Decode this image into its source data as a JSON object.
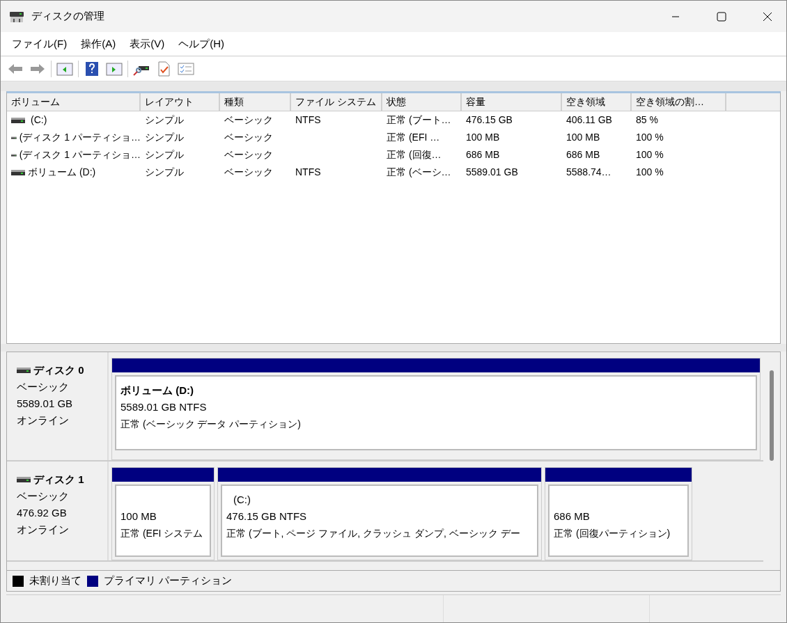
{
  "window": {
    "title": "ディスクの管理"
  },
  "menu": [
    "ファイル(F)",
    "操作(A)",
    "表示(V)",
    "ヘルプ(H)"
  ],
  "table": {
    "columns": [
      "ボリューム",
      "レイアウト",
      "種類",
      "ファイル システム",
      "状態",
      "容量",
      "空き領域",
      "空き領域の割…"
    ],
    "rows": [
      [
        "(C:)",
        "シンプル",
        "ベーシック",
        "NTFS",
        "正常 (ブート…",
        "476.15 GB",
        "406.11 GB",
        "85 %"
      ],
      [
        "(ディスク 1 パーティショ…",
        "シンプル",
        "ベーシック",
        "",
        "正常 (EFI …",
        "100 MB",
        "100 MB",
        "100 %"
      ],
      [
        "(ディスク 1 パーティショ…",
        "シンプル",
        "ベーシック",
        "",
        "正常 (回復…",
        "686 MB",
        "686 MB",
        "100 %"
      ],
      [
        "ボリューム (D:)",
        "シンプル",
        "ベーシック",
        "NTFS",
        "正常 (ベーシ…",
        "5589.01 GB",
        "5588.74…",
        "100 %"
      ]
    ]
  },
  "disks": [
    {
      "name": "ディスク 0",
      "type": "ベーシック",
      "size": "5589.01 GB",
      "status": "オンライン",
      "partitions": [
        {
          "name": "ボリューム (D:)",
          "size": "5589.01 GB NTFS",
          "status": "正常 (ベーシック データ パーティション)"
        }
      ]
    },
    {
      "name": "ディスク 1",
      "type": "ベーシック",
      "size": "476.92 GB",
      "status": "オンライン",
      "partitions": [
        {
          "size": "100 MB",
          "status": "正常 (EFI システム"
        },
        {
          "name": "(C:)",
          "size": "476.15 GB NTFS",
          "status": "正常 (ブート, ページ ファイル, クラッシュ ダンプ, ベーシック デー"
        },
        {
          "size": "686 MB",
          "status": "正常 (回復パーティション)"
        }
      ]
    }
  ],
  "legend": [
    {
      "label": "未割り当て",
      "color": "#000000"
    },
    {
      "label": "プライマリ パーティション",
      "color": "#000080"
    }
  ]
}
